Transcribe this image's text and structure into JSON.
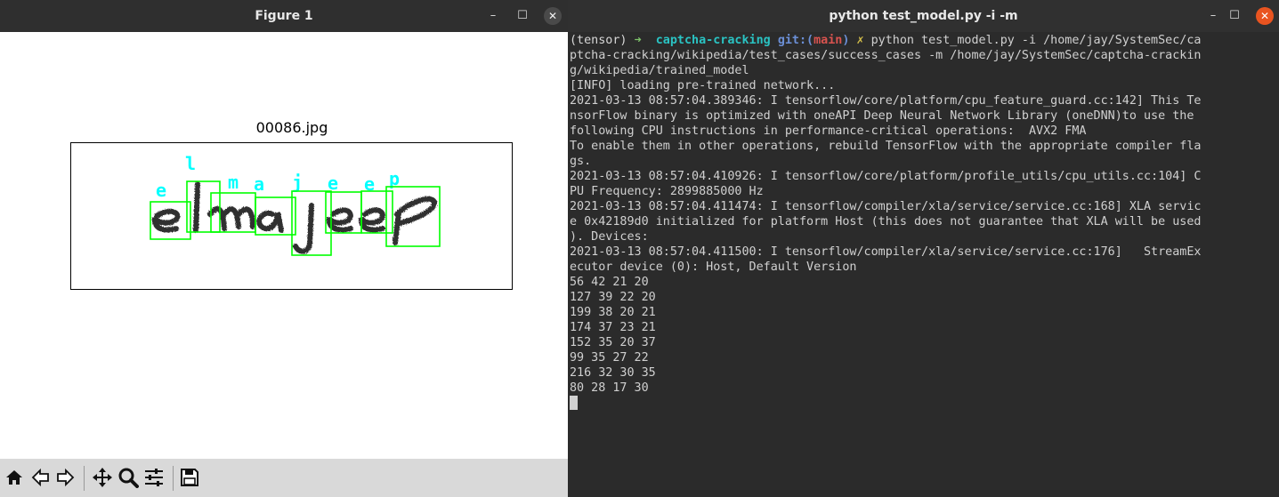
{
  "figure_window": {
    "title": "Figure 1",
    "controls": {
      "minimize": "–",
      "maximize": "☐",
      "close": "✕"
    },
    "image_title": "00086.jpg",
    "predicted_chars": [
      "e",
      "l",
      "m",
      "a",
      "j",
      "e",
      "e",
      "p"
    ],
    "captcha_text_shown": "elmajeep",
    "box_color": "#00ff00",
    "label_color": "#00ffff",
    "toolbar": [
      "home-icon",
      "back-icon",
      "forward-icon",
      "pan-icon",
      "zoom-icon",
      "configure-subplots-icon",
      "save-icon"
    ]
  },
  "terminal_window": {
    "title": "python test_model.py -i  -m",
    "controls": {
      "minimize": "–",
      "maximize": "☐",
      "close": "✕"
    },
    "prompt": {
      "env": "(tensor)",
      "arrow": "➜",
      "dir": "captcha-cracking",
      "git_label": "git:(",
      "branch": "main",
      "git_close": ")",
      "dirty": "✗",
      "command": "python test_model.py -i /home/jay/SystemSec/ca",
      "command_wrap": [
        "ptcha-cracking/wikipedia/test_cases/success_cases -m /home/jay/SystemSec/captcha-crackin",
        "g/wikipedia/trained_model"
      ]
    },
    "lines": [
      "[INFO] loading pre-trained network...",
      "2021-03-13 08:57:04.389346: I tensorflow/core/platform/cpu_feature_guard.cc:142] This Te",
      "nsorFlow binary is optimized with oneAPI Deep Neural Network Library (oneDNN)to use the",
      "following CPU instructions in performance-critical operations:  AVX2 FMA",
      "To enable them in other operations, rebuild TensorFlow with the appropriate compiler fla",
      "gs.",
      "2021-03-13 08:57:04.410926: I tensorflow/core/platform/profile_utils/cpu_utils.cc:104] C",
      "PU Frequency: 2899885000 Hz",
      "2021-03-13 08:57:04.411474: I tensorflow/compiler/xla/service/service.cc:168] XLA servic",
      "e 0x42189d0 initialized for platform Host (this does not guarantee that XLA will be used",
      "). Devices:",
      "2021-03-13 08:57:04.411500: I tensorflow/compiler/xla/service/service.cc:176]   StreamEx",
      "ecutor device (0): Host, Default Version",
      "56 42 21 20",
      "127 39 22 20",
      "199 38 20 21",
      "174 37 23 21",
      "152 35 20 37",
      "99 35 27 22",
      "216 32 30 35",
      "80 28 17 30"
    ]
  }
}
